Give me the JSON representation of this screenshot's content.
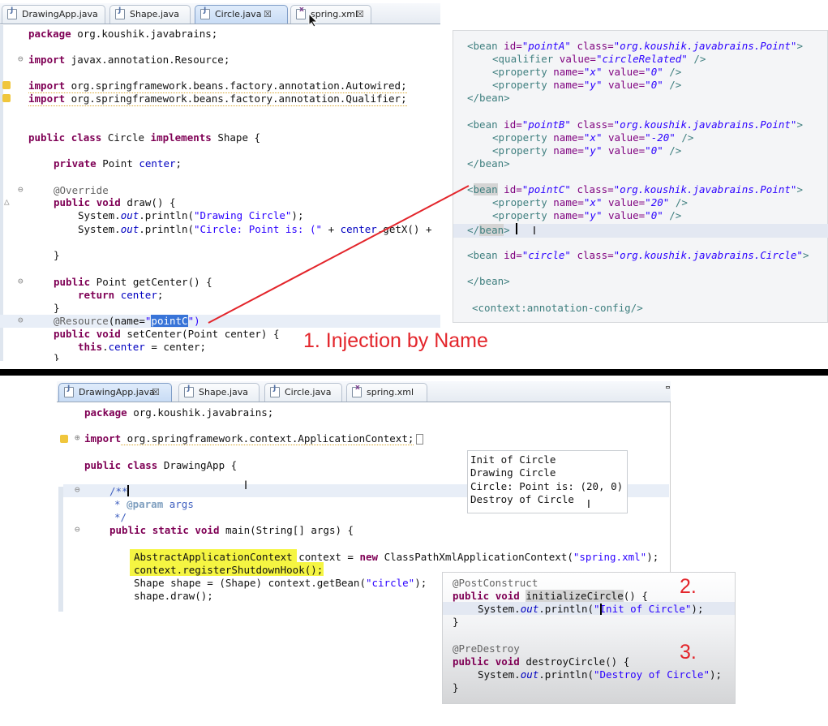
{
  "top_editor": {
    "tabs": [
      {
        "label": "DrawingApp.java"
      },
      {
        "label": "Shape.java"
      },
      {
        "label": "Circle.java"
      },
      {
        "label": "spring.xml"
      }
    ],
    "close_glyph": "☒",
    "lines": {
      "l1a": "package",
      "l1b": " org.koushik.javabrains;",
      "l2a": "import",
      "l2b": " javax.annotation.Resource;",
      "l3a": "import",
      "l3b": " org.springframework.beans.factory.annotation.Autowired;",
      "l4a": "import",
      "l4b": " org.springframework.beans.factory.annotation.Qualifier;",
      "l5a": "public",
      "l5b": " ",
      "l5c": "class",
      "l5d": " Circle ",
      "l5e": "implements",
      "l5f": " Shape {",
      "l6a": "private",
      "l6b": " Point ",
      "l6c": "center",
      "l6d": ";",
      "l7": "@Override",
      "l8a": "public",
      "l8b": " ",
      "l8c": "void",
      "l8d": " draw() {",
      "l9a": "System.",
      "l9b": "out",
      "l9c": ".println(",
      "l9d": "\"Drawing Circle\"",
      "l9e": ");",
      "l10a": "System.",
      "l10b": "out",
      "l10c": ".println(",
      "l10d": "\"Circle: Point is: (\"",
      "l10e": " + ",
      "l10f": "center",
      "l10g": ".getX() +",
      "l11": "}",
      "l12a": "public",
      "l12b": " Point getCenter() {",
      "l13a": "return",
      "l13b": " ",
      "l13c": "center",
      "l13d": ";",
      "l14": "}",
      "l15a": "@Resource",
      "l15b": "(name=",
      "l15c": "\"",
      "l15d": "pointC",
      "l15e": "\")",
      "l16a": "public",
      "l16b": " ",
      "l16c": "void",
      "l16d": " setCenter(Point center) {",
      "l17a": "this",
      "l17b": ".",
      "l17c": "center",
      "l17d": " = center;",
      "l18": "}"
    }
  },
  "xml": {
    "a1": "<bean",
    "a2": "id=",
    "a3": "\"pointA\"",
    "a4": "class=",
    "a5": "\"org.koushik.javabrains.Point\"",
    "a6": ">",
    "a7": "<qualifier",
    "a8": "value=",
    "a9": "\"circleRelated\"",
    "a10": "/>",
    "p1": "<property",
    "n1": "name=",
    "v1": "\"x\"",
    "w1": "value=",
    "z1": "\"0\"",
    "e1": "/>",
    "p2": "<property",
    "n2": "name=",
    "v2": "\"y\"",
    "w2": "value=",
    "z2": "\"0\"",
    "e2": "/>",
    "endbean": "</bean>",
    "b3": "\"pointB\"",
    "p3": "<property",
    "v3": "\"x\"",
    "z3": "\"-20\"",
    "p4": "<property",
    "v4": "\"y\"",
    "z4": "\"0\"",
    "c1": "bean",
    "c3": "\"pointC\"",
    "z5": "\"20\"",
    "z6": "\"0\"",
    "endbeanC1": "</",
    "endbeanC2": "bean",
    "endbeanC3": ">",
    "d3": "\"circle\"",
    "d5": "\"org.koushik.javabrains.Circle\"",
    "ctx": "<context:annotation-config/>",
    "lt": "<"
  },
  "annotation_label": "1. Injection by Name",
  "bottom_editor": {
    "tabs": [
      {
        "label": "DrawingApp.java"
      },
      {
        "label": "Shape.java"
      },
      {
        "label": "Circle.java"
      },
      {
        "label": "spring.xml"
      }
    ],
    "lines": {
      "b1a": "package",
      "b1b": " org.koushik.javabrains;",
      "b2a": "import",
      "b2b": " org.springframework.context.ApplicationContext;",
      "b3a": "public",
      "b3b": " ",
      "b3c": "class",
      "b3d": " DrawingApp {",
      "b4": "/**",
      "b5a": "* ",
      "b5b": "@param",
      "b5c": " args",
      "b6": "*/",
      "b7a": "public",
      "b7b": " ",
      "b7c": "static",
      "b7d": " ",
      "b7e": "void",
      "b7f": " main(String[] args) {",
      "b8a": "AbstractApplicationContext",
      "b8b": " context = ",
      "b8c": "new",
      "b8d": " ClassPathXmlApplicationContext(",
      "b8e": "\"spring.xml\"",
      "b8f": ");",
      "b9": "context.registerShutdownHook();",
      "b10a": "Shape shape = (Shape) context.getBean(",
      "b10b": "\"circle\"",
      "b10c": ");",
      "b11": "shape.draw();"
    }
  },
  "console": [
    "Init of Circle",
    "Drawing Circle",
    "Circle: Point is: (20, 0)",
    "Destroy of Circle"
  ],
  "lifecycle": {
    "pc": "@PostConstruct",
    "m1a": "public",
    "m1b": " ",
    "m1c": "void",
    "m1d": " ",
    "m1e": "initializeCircle",
    "m1f": "() {",
    "s1a": "System.",
    "s1b": "out",
    "s1c": ".println(",
    "s1d": "\"Init of Circle\"",
    "s1e": ");",
    "close": "}",
    "pd": "@PreDestroy",
    "m2a": "public",
    "m2b": " ",
    "m2c": "void",
    "m2d": " destroyCircle() {",
    "s2a": "System.",
    "s2b": "out",
    "s2c": ".println(",
    "s2d": "\"Destroy of Circle\"",
    "s2e": ");",
    "n2": "2.",
    "n3": "3."
  },
  "colors": {
    "annotation_red": "#e3252b",
    "highlight_yellow": "#f5f542",
    "selection_blue": "#3874d8"
  }
}
